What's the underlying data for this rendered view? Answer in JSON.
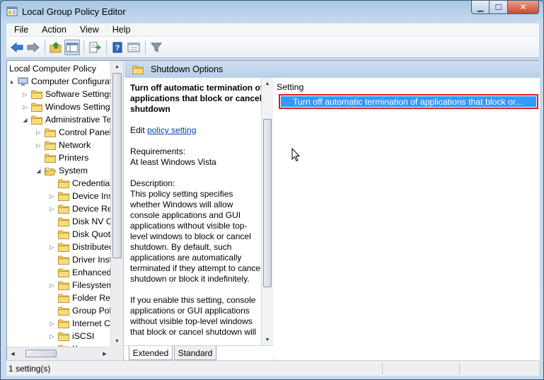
{
  "window": {
    "title": "Local Group Policy Editor"
  },
  "menu": [
    "File",
    "Action",
    "View",
    "Help"
  ],
  "toolbar": {
    "buttons": [
      "back-arrow-icon",
      "forward-arrow-icon",
      "up-folder-icon",
      "show-hide-tree-icon",
      "export-list-icon",
      "help-icon",
      "properties-view-icon",
      "filter-icon"
    ]
  },
  "tree": {
    "items": [
      {
        "label": "Local Computer Policy",
        "level": 0,
        "expander": "",
        "icon": "none"
      },
      {
        "label": "Computer Configurati",
        "level": 0,
        "expander": "▲",
        "icon": "computer"
      },
      {
        "label": "Software Settings",
        "level": 1,
        "expander": "▷",
        "icon": "folder"
      },
      {
        "label": "Windows Settings",
        "level": 1,
        "expander": "▷",
        "icon": "folder"
      },
      {
        "label": "Administrative Ter",
        "level": 1,
        "expander": "◢",
        "icon": "folder"
      },
      {
        "label": "Control Panel",
        "level": 2,
        "expander": "▷",
        "icon": "folder"
      },
      {
        "label": "Network",
        "level": 2,
        "expander": "▷",
        "icon": "folder"
      },
      {
        "label": "Printers",
        "level": 2,
        "expander": "",
        "icon": "folder"
      },
      {
        "label": "System",
        "level": 2,
        "expander": "◢",
        "icon": "folder-open"
      },
      {
        "label": "Credentials",
        "level": 3,
        "expander": "",
        "icon": "folder"
      },
      {
        "label": "Device Insta",
        "level": 3,
        "expander": "▷",
        "icon": "folder"
      },
      {
        "label": "Device Red",
        "level": 3,
        "expander": "▷",
        "icon": "folder"
      },
      {
        "label": "Disk NV Ca",
        "level": 3,
        "expander": "",
        "icon": "folder"
      },
      {
        "label": "Disk Quota",
        "level": 3,
        "expander": "",
        "icon": "folder"
      },
      {
        "label": "Distributed",
        "level": 3,
        "expander": "▷",
        "icon": "folder"
      },
      {
        "label": "Driver Insta",
        "level": 3,
        "expander": "",
        "icon": "folder"
      },
      {
        "label": "Enhanced S",
        "level": 3,
        "expander": "",
        "icon": "folder"
      },
      {
        "label": "Filesystem",
        "level": 3,
        "expander": "▷",
        "icon": "folder"
      },
      {
        "label": "Folder Redi",
        "level": 3,
        "expander": "",
        "icon": "folder"
      },
      {
        "label": "Group Polic",
        "level": 3,
        "expander": "",
        "icon": "folder"
      },
      {
        "label": "Internet Co",
        "level": 3,
        "expander": "▷",
        "icon": "folder"
      },
      {
        "label": "iSCSI",
        "level": 3,
        "expander": "▷",
        "icon": "folder"
      },
      {
        "label": "Ker",
        "level": 3,
        "expander": "",
        "icon": "folder"
      }
    ]
  },
  "pane": {
    "folder_title": "Shutdown Options"
  },
  "extended": {
    "title": "Turn off automatic termination of applications that block or cancel shutdown",
    "edit_prefix": "Edit ",
    "edit_link": "policy setting ",
    "requirements_label": "Requirements:",
    "requirements_value": "At least Windows Vista",
    "description_label": "Description:",
    "description": "This policy setting specifies whether Windows will allow console applications and GUI applications without visible top-level windows to block or cancel shutdown. By default, such applications are automatically terminated if they attempt to cancel shutdown or block it indefinitely.",
    "description2": "If you enable this setting, console applications or GUI applications without visible top-level windows that block or cancel shutdown will"
  },
  "list": {
    "column_header": "Setting",
    "rows": [
      {
        "label": "Turn off automatic termination of applications that block or..."
      }
    ]
  },
  "tabs": [
    {
      "label": "Extended",
      "active": true
    },
    {
      "label": "Standard",
      "active": false
    }
  ],
  "status": {
    "text": "1 setting(s)"
  },
  "colors": {
    "selection": "#3399ff",
    "highlight_border": "#d81a1a",
    "link": "#0645ad"
  }
}
